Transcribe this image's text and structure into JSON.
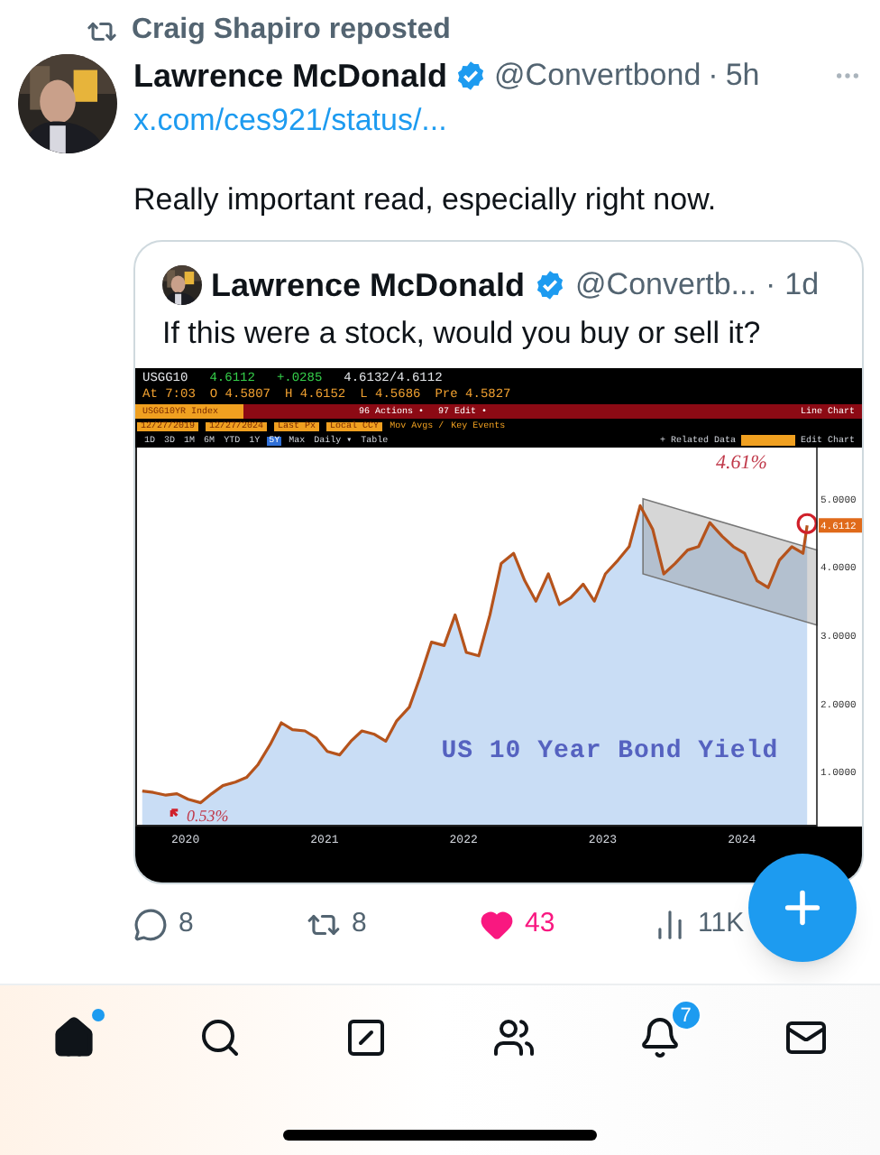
{
  "repost_line": "Craig Shapiro reposted",
  "post": {
    "author": "Lawrence McDonald",
    "verified": true,
    "handle": "@Convertbond",
    "separator": "·",
    "time": "5h",
    "link": "x.com/ces921/status/...",
    "text": "Really important read, especially right now."
  },
  "quote": {
    "author": "Lawrence McDonald",
    "verified": true,
    "handle": "@Convertb...",
    "separator": "·",
    "time": "1d",
    "text": "If this were a stock, would you buy or sell it?",
    "terminal": {
      "ticker": "USGG10",
      "last": "4.6112",
      "change": "+.0285",
      "bid_ask": "4.6132/4.6112",
      "stats": [
        "At 7:03",
        "O 4.5807",
        "H 4.6152",
        "L 4.5686",
        "Pre 4.5827"
      ],
      "menu": [
        "USGG10YR Index",
        "96 Actions •",
        "97 Edit •",
        "Line Chart"
      ],
      "range": [
        "12/27/2019",
        "12/27/2024",
        "Last Px",
        "Local CCY",
        "Mov Avgs /",
        "Key Events"
      ],
      "periods": [
        {
          "label": "1D",
          "selected": false
        },
        {
          "label": "3D",
          "selected": false
        },
        {
          "label": "1M",
          "selected": false
        },
        {
          "label": "6M",
          "selected": false
        },
        {
          "label": "YTD",
          "selected": false
        },
        {
          "label": "1Y",
          "selected": false
        },
        {
          "label": "5Y",
          "selected": true
        },
        {
          "label": "Max",
          "selected": false
        },
        {
          "label": "Daily ▾",
          "selected": false
        },
        {
          "label": "Table",
          "selected": false
        }
      ],
      "tools": [
        "+ Related Data",
        "Edit Chart"
      ],
      "price_tag": "4.6112",
      "chart_data": {
        "type": "line",
        "x": [
          2020.2,
          2020.28,
          2020.37,
          2020.45,
          2020.53,
          2020.62,
          2020.7,
          2020.78,
          2020.87,
          2020.95,
          2021.03,
          2021.12,
          2021.2,
          2021.28,
          2021.37,
          2021.45,
          2021.53,
          2021.62,
          2021.7,
          2021.78,
          2021.87,
          2021.95,
          2022.03,
          2022.12,
          2022.2,
          2022.28,
          2022.37,
          2022.45,
          2022.53,
          2022.62,
          2022.7,
          2022.78,
          2022.87,
          2022.95,
          2023.03,
          2023.12,
          2023.2,
          2023.28,
          2023.37,
          2023.45,
          2023.53,
          2023.62,
          2023.7,
          2023.78,
          2023.87,
          2023.95,
          2024.03,
          2024.12,
          2024.2,
          2024.28,
          2024.37,
          2024.45,
          2024.53,
          2024.62,
          2024.7,
          2024.78,
          2024.87,
          2024.95,
          2024.98
        ],
        "series": [
          {
            "color": "#b5531c",
            "values": [
              0.72,
              0.7,
              0.66,
              0.68,
              0.6,
              0.55,
              0.68,
              0.8,
              0.85,
              0.92,
              1.1,
              1.4,
              1.72,
              1.62,
              1.6,
              1.5,
              1.3,
              1.25,
              1.45,
              1.6,
              1.55,
              1.45,
              1.75,
              1.95,
              2.4,
              2.9,
              2.85,
              3.3,
              2.75,
              2.7,
              3.3,
              4.05,
              4.2,
              3.8,
              3.5,
              3.9,
              3.45,
              3.55,
              3.75,
              3.5,
              3.9,
              4.1,
              4.3,
              4.9,
              4.55,
              3.9,
              4.05,
              4.25,
              4.3,
              4.65,
              4.45,
              4.3,
              4.2,
              3.8,
              3.7,
              4.1,
              4.3,
              4.2,
              4.61
            ]
          }
        ],
        "xlim": [
          2020.15,
          2025.05
        ],
        "ylim": [
          0.2,
          5.75
        ],
        "xticks": [
          {
            "value": 2020.5,
            "label": "2020"
          },
          {
            "value": 2021.5,
            "label": "2021"
          },
          {
            "value": 2022.5,
            "label": "2022"
          },
          {
            "value": 2023.5,
            "label": "2023"
          },
          {
            "value": 2024.5,
            "label": "2024"
          }
        ],
        "yticks": [
          {
            "value": 1,
            "label": "1.0000"
          },
          {
            "value": 2,
            "label": "2.0000"
          },
          {
            "value": 3,
            "label": "3.0000"
          },
          {
            "value": 4,
            "label": "4.0000"
          },
          {
            "value": 5,
            "label": "5.0000"
          }
        ],
        "annotations": [
          "4.61%",
          "0.53%",
          "US 10 Year Bond Yield"
        ]
      }
    }
  },
  "actions": [
    {
      "kind": "reply",
      "count": "8"
    },
    {
      "kind": "repost",
      "count": "8"
    },
    {
      "kind": "like",
      "count": "43",
      "liked": true
    },
    {
      "kind": "views",
      "count": "11K"
    }
  ],
  "nav": [
    {
      "kind": "home",
      "selected": true,
      "dot": true
    },
    {
      "kind": "search",
      "selected": false
    },
    {
      "kind": "grok",
      "selected": false
    },
    {
      "kind": "communities",
      "selected": false
    },
    {
      "kind": "notifications",
      "selected": false,
      "badge": "7"
    },
    {
      "kind": "messages",
      "selected": false
    }
  ]
}
